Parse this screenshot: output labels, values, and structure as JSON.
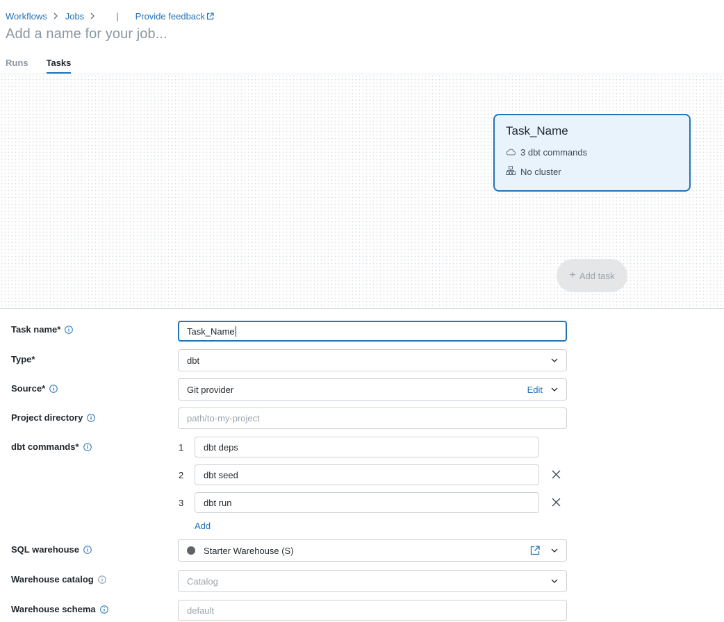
{
  "breadcrumb": {
    "workflows": "Workflows",
    "jobs": "Jobs",
    "divider": "|",
    "feedback": "Provide feedback"
  },
  "job": {
    "name_placeholder": "Add a name for your job..."
  },
  "tabs": [
    {
      "label": "Runs"
    },
    {
      "label": "Tasks"
    }
  ],
  "active_tab": "Tasks",
  "task_card": {
    "name": "Task_Name",
    "commands_summary": "3 dbt commands",
    "cluster": "No cluster"
  },
  "add_task": {
    "label": "Add task"
  },
  "form": {
    "task_name": {
      "label": "Task name*",
      "value": "Task_Name"
    },
    "type": {
      "label": "Type*",
      "value": "dbt"
    },
    "source": {
      "label": "Source*",
      "value": "Git provider",
      "edit_label": "Edit"
    },
    "project_directory": {
      "label": "Project directory",
      "placeholder": "path/to-my-project"
    },
    "dbt_commands": {
      "label": "dbt commands*",
      "items": [
        {
          "num": "1",
          "value": "dbt deps"
        },
        {
          "num": "2",
          "value": "dbt seed"
        },
        {
          "num": "3",
          "value": "dbt run"
        }
      ],
      "add_label": "Add"
    },
    "sql_warehouse": {
      "label": "SQL warehouse",
      "value": "Starter Warehouse (S)"
    },
    "warehouse_catalog": {
      "label": "Warehouse catalog",
      "placeholder": "Catalog"
    },
    "warehouse_schema": {
      "label": "Warehouse schema",
      "placeholder": "default"
    }
  },
  "colors": {
    "accent": "#2272b4",
    "card_bg": "#e9f3fc",
    "muted": "#8b97a1"
  },
  "icons": [
    "chevron-right-icon",
    "external-link-icon",
    "cloud-icon",
    "cluster-icon",
    "plus-icon",
    "info-icon",
    "chevron-down-icon",
    "close-icon",
    "status-dot-icon"
  ]
}
